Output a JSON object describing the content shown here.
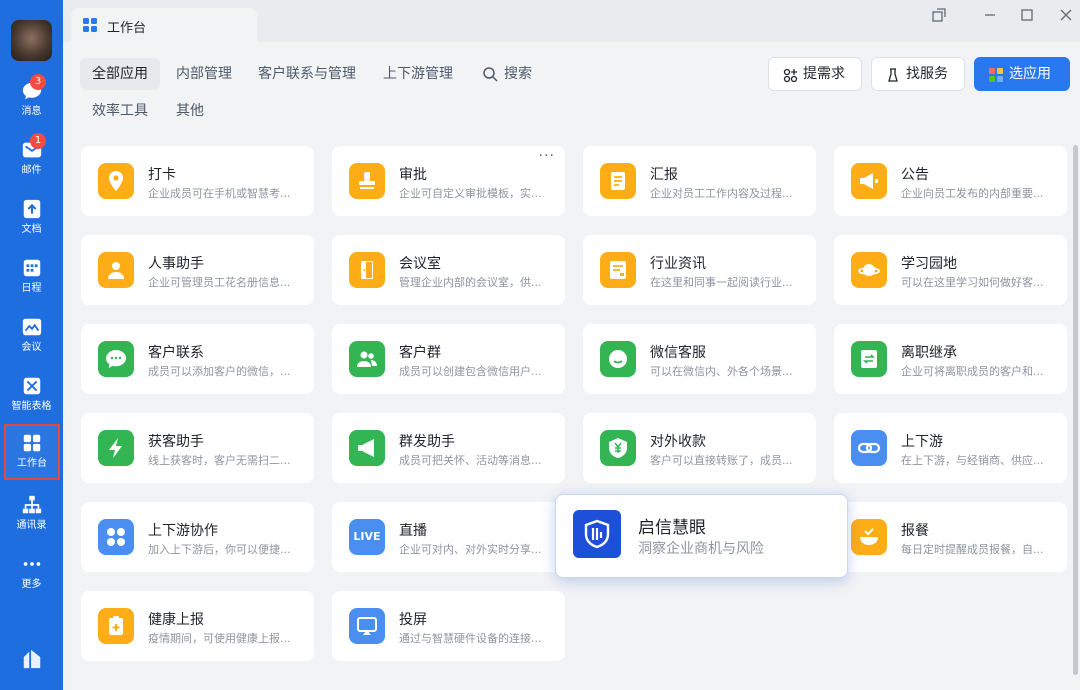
{
  "window": {
    "tab_title": "工作台"
  },
  "sidebar": {
    "items": [
      {
        "label": "消息",
        "icon": "chat-bubble-icon",
        "badge": "3"
      },
      {
        "label": "邮件",
        "icon": "mail-icon",
        "badge": "1"
      },
      {
        "label": "文档",
        "icon": "document-icon"
      },
      {
        "label": "日程",
        "icon": "calendar-icon"
      },
      {
        "label": "会议",
        "icon": "meeting-icon"
      },
      {
        "label": "智能表格",
        "icon": "smart-sheet-icon"
      },
      {
        "label": "工作台",
        "icon": "workbench-icon"
      },
      {
        "label": "通讯录",
        "icon": "org-chart-icon"
      },
      {
        "label": "更多",
        "icon": "more-dots-icon"
      }
    ]
  },
  "categories": [
    "全部应用",
    "内部管理",
    "客户联系与管理",
    "上下游管理",
    "搜索",
    "效率工具",
    "其他"
  ],
  "actions": {
    "request": "提需求",
    "service": "找服务",
    "select": "选应用"
  },
  "apps": [
    {
      "name": "打卡",
      "desc": "企业成员可在手机或智慧考..."
    },
    {
      "name": "审批",
      "desc": "企业可自定义审批模板，实..."
    },
    {
      "name": "汇报",
      "desc": "企业对员工工作内容及过程..."
    },
    {
      "name": "公告",
      "desc": "企业向员工发布的内部重要..."
    },
    {
      "name": "人事助手",
      "desc": "企业可管理员工花名册信息..."
    },
    {
      "name": "会议室",
      "desc": "管理企业内部的会议室，供..."
    },
    {
      "name": "行业资讯",
      "desc": "在这里和同事一起阅读行业..."
    },
    {
      "name": "学习园地",
      "desc": "可以在这里学习如何做好客..."
    },
    {
      "name": "客户联系",
      "desc": "成员可以添加客户的微信，..."
    },
    {
      "name": "客户群",
      "desc": "成员可以创建包含微信用户..."
    },
    {
      "name": "微信客服",
      "desc": "可以在微信内、外各个场景..."
    },
    {
      "name": "离职继承",
      "desc": "企业可将离职成员的客户和..."
    },
    {
      "name": "获客助手",
      "desc": "线上获客时，客户无需扫二..."
    },
    {
      "name": "群发助手",
      "desc": "成员可把关怀、活动等消息..."
    },
    {
      "name": "对外收款",
      "desc": "客户可以直接转账了，成员..."
    },
    {
      "name": "上下游",
      "desc": "在上下游，与经销商、供应..."
    },
    {
      "name": "上下游协作",
      "desc": "加入上下游后，你可以便捷..."
    },
    {
      "name": "直播",
      "desc": "企业可对内、对外实时分享...",
      "icon_text": "LIVE"
    },
    {
      "name": "报餐",
      "desc": "每日定时提醒成员报餐，自..."
    },
    {
      "name": "健康上报",
      "desc": "疫情期间，可使用健康上报..."
    },
    {
      "name": "投屏",
      "desc": "通过与智慧硬件设备的连接..."
    }
  ],
  "featured": {
    "name": "启信慧眼",
    "desc": "洞察企业商机与风险"
  },
  "colors": {
    "sidebar": "#1e6ee0",
    "primary": "#2a78f0",
    "yellow": "#ffad17",
    "green": "#34b553",
    "blue": "#4a8ef2",
    "featured": "#1d4fd8"
  }
}
